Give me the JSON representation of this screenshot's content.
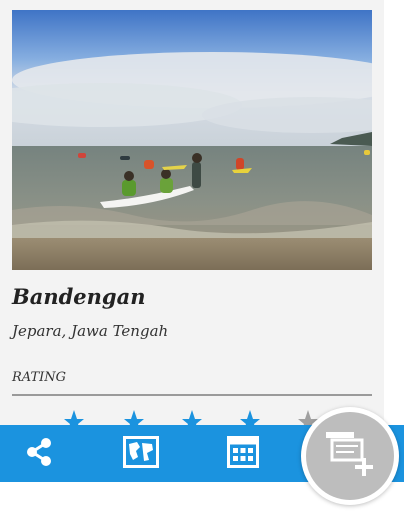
{
  "place": {
    "name": "Bandengan",
    "location": "Jepara, Jawa Tengah",
    "photo_icon": "beach-photo"
  },
  "rating": {
    "label": "RATING",
    "star_count": 5
  },
  "bottom_bar": {
    "color": "#1b93df",
    "items": [
      {
        "icon": "share-icon"
      },
      {
        "icon": "map-icon"
      },
      {
        "icon": "grid-icon"
      }
    ]
  },
  "fab": {
    "icon": "add-note-icon",
    "color": "#bdbdbd"
  }
}
